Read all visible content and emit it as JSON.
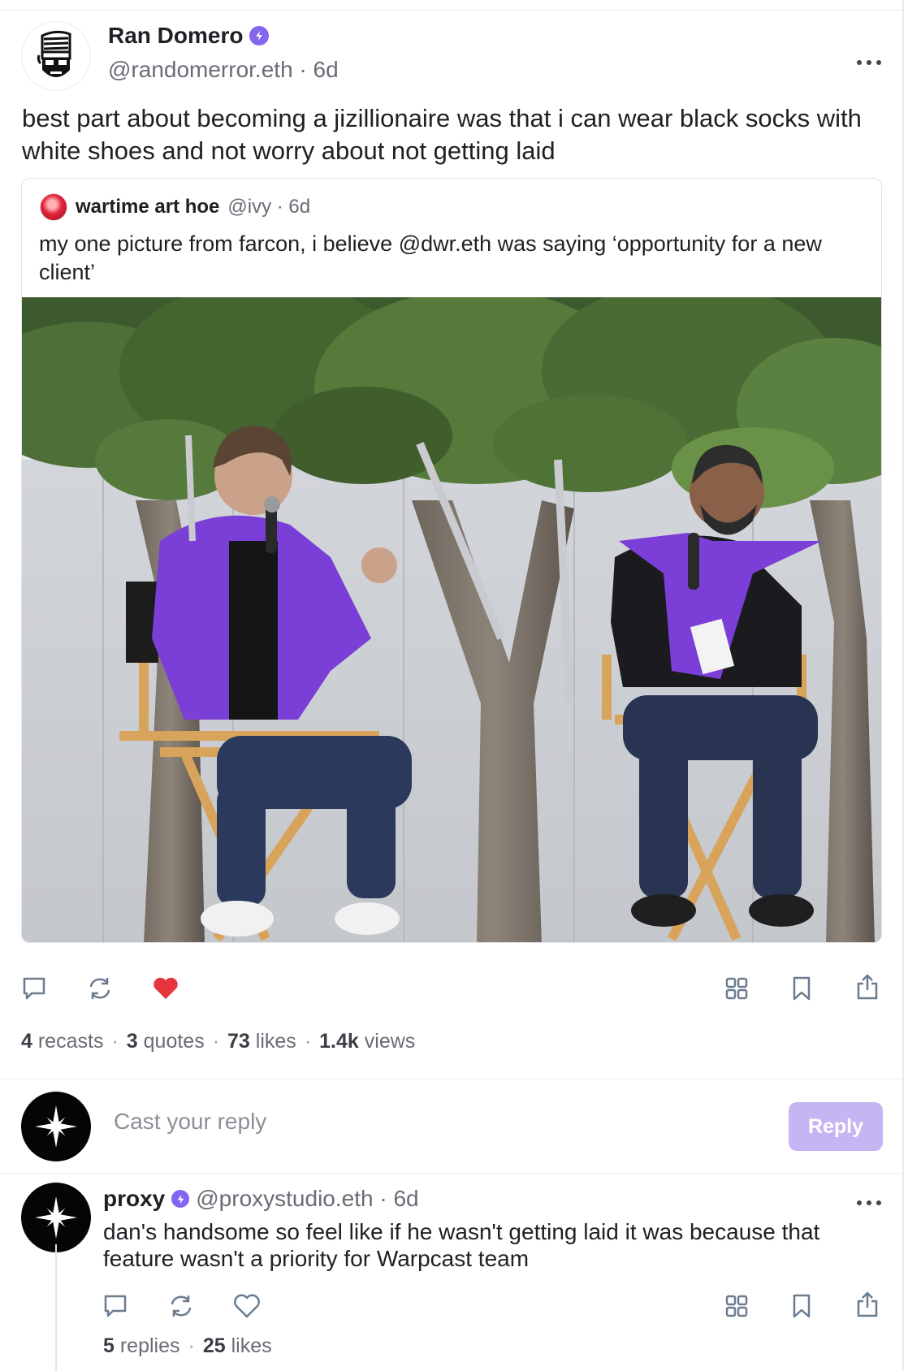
{
  "post": {
    "author_name": "Ran Domero",
    "author_handle": "@randomerror.eth",
    "time": "6d",
    "handle_line": "@randomerror.eth · 6d",
    "text": "best part about becoming a jizillionaire was that i can wear black socks with white shoes and not worry about not getting laid",
    "quote": {
      "author_name": "wartime art hoe",
      "meta": "@ivy · 6d",
      "text": "my one picture from farcon, i believe @dwr.eth was saying ‘opportunity for a new client’"
    },
    "stats": {
      "recasts_count": "4",
      "recasts_label": "recasts",
      "quotes_count": "3",
      "quotes_label": "quotes",
      "likes_count": "73",
      "likes_label": "likes",
      "views_count": "1.4k",
      "views_label": "views",
      "separator": "·"
    },
    "liked": true,
    "like_color": "#e8343e"
  },
  "reply_box": {
    "placeholder": "Cast your reply",
    "button_label": "Reply"
  },
  "comment": {
    "author_name": "proxy",
    "meta": "@proxystudio.eth · 6d",
    "text": "dan's handsome so feel like if he wasn't getting laid it was because that feature wasn't a priority for Warpcast team",
    "replies_count": "5",
    "replies_label": "replies",
    "likes_count": "25",
    "likes_label": "likes",
    "separator": "·"
  },
  "icons": {
    "reply": "comment-bubble-icon",
    "recast": "recast-arrows-icon",
    "like": "heart-icon",
    "apps": "grid-icon",
    "bookmark": "bookmark-icon",
    "share": "share-icon",
    "more": "more-dots-icon",
    "verified": "verified-badge-icon"
  },
  "colors": {
    "accent": "#8465f0",
    "reply_button": "#c5b5f2",
    "muted_text": "#6b6b76"
  }
}
